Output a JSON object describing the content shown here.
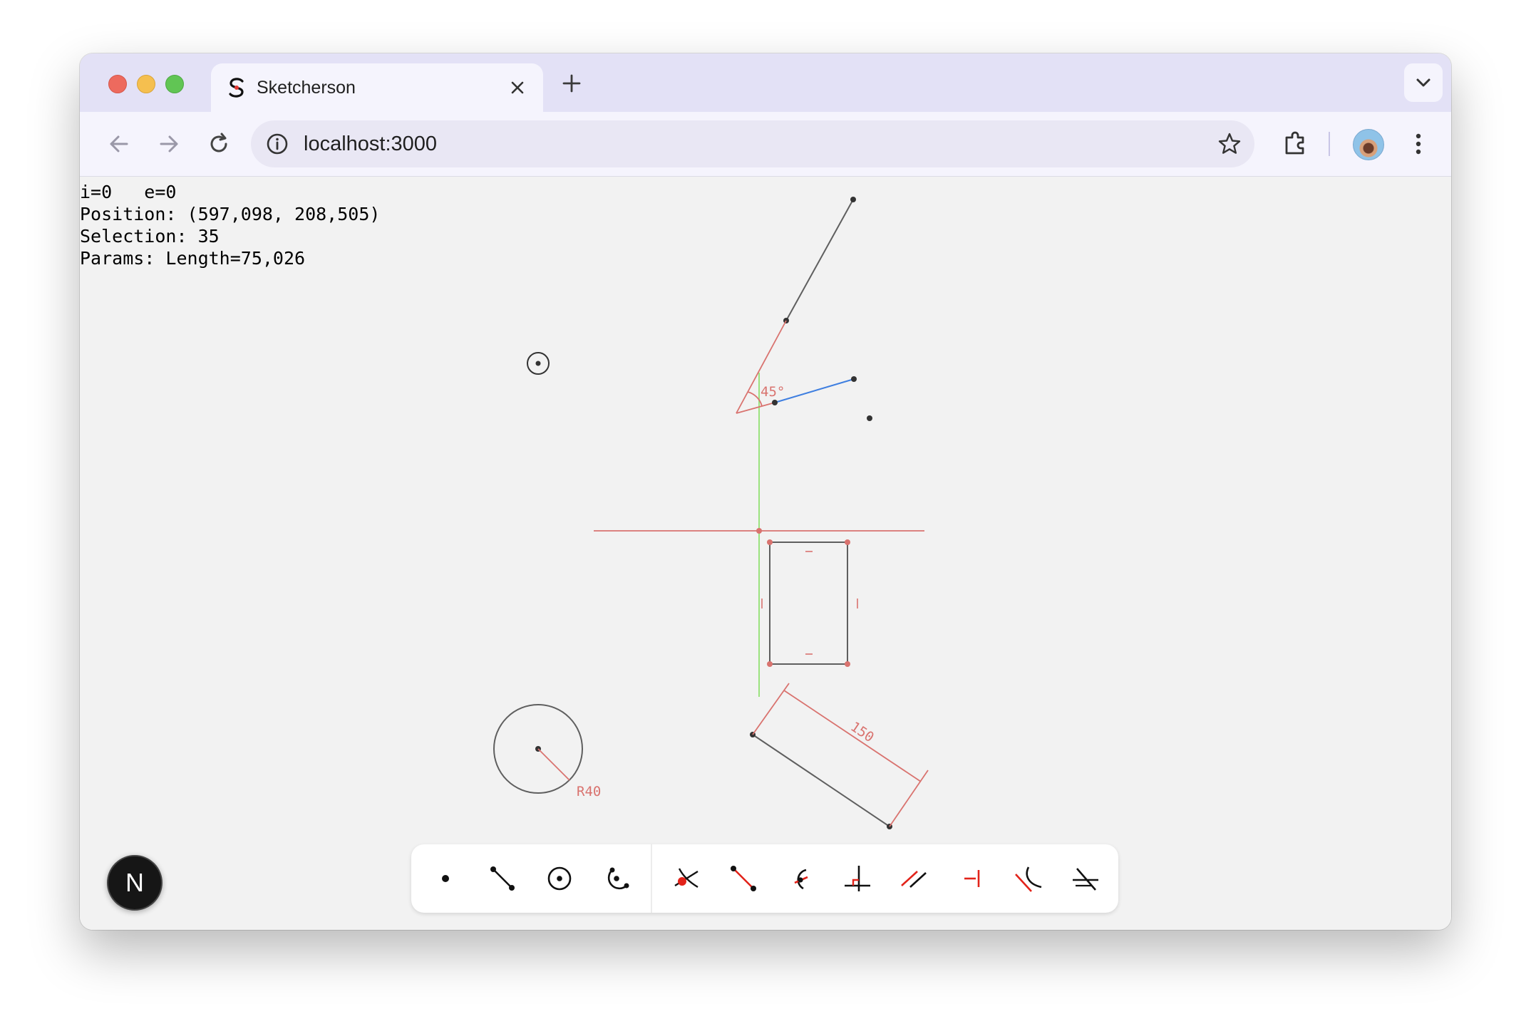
{
  "browser": {
    "tab": {
      "title": "Sketcherson",
      "favicon_letter": "S"
    },
    "omnibox": {
      "url": "localhost:3000"
    }
  },
  "hud": {
    "line1": "i=0   e=0",
    "line2": "Position: (597,098, 208,505)",
    "line3": "Selection: 35",
    "line4": "Params: Length=75,026"
  },
  "sketch": {
    "angle_label": "45°",
    "dimension_label": "150",
    "radius_label": "R40",
    "colors": {
      "geometry": "#5f5f5f",
      "constraint": "#d9736f",
      "selected": "#3f7fe0",
      "axis": "#9be37f"
    }
  },
  "palette": {
    "tools": [
      "point-tool-icon",
      "line-tool-icon",
      "circle-tool-icon",
      "arc-tool-icon",
      "coincident-constraint-icon",
      "point-on-line-constraint-icon",
      "point-on-arc-constraint-icon",
      "perpendicular-constraint-icon",
      "parallel-constraint-icon",
      "horizontal-distance-icon",
      "tangent-constraint-icon",
      "angle-constraint-icon"
    ]
  },
  "next_badge": {
    "letter": "N"
  }
}
